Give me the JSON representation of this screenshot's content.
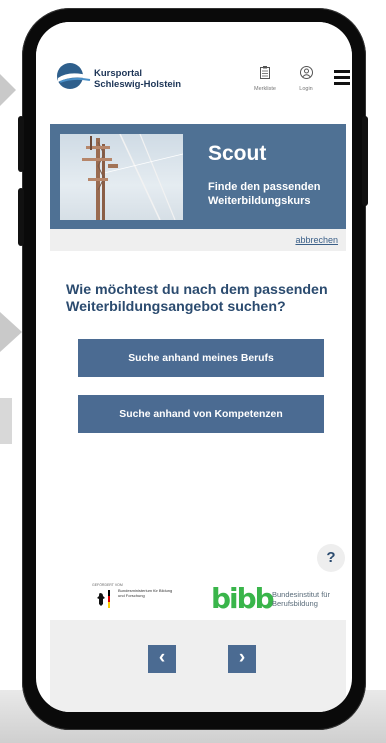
{
  "header": {
    "brand_line1": "Kursportal",
    "brand_line2": "Schleswig-Holstein",
    "merkliste_label": "Merkliste",
    "login_label": "Login"
  },
  "hero": {
    "title": "Scout",
    "subtitle": "Finde den passenden Weiterbildungskurs"
  },
  "cancel_link": "abbrechen",
  "question": "Wie möchtest du nach dem passenden Weiterbildungsangebot suchen?",
  "buttons": {
    "by_profession": "Suche anhand meines Berufs",
    "by_competence": "Suche anhand von Kompetenzen"
  },
  "help_label": "?",
  "funding": {
    "caption": "GEFÖRDERT VOM",
    "ministry": "Bundesministerium für Bildung und Forschung",
    "bibb_logo": "bibb",
    "bibb_name": "Bundesinstitut für Berufsbildung"
  },
  "nav": {
    "prev": "‹",
    "next": "›"
  },
  "colors": {
    "primary": "#4b6b92",
    "bibb_green": "#39b54a",
    "hero_bg": "#4f7194"
  }
}
